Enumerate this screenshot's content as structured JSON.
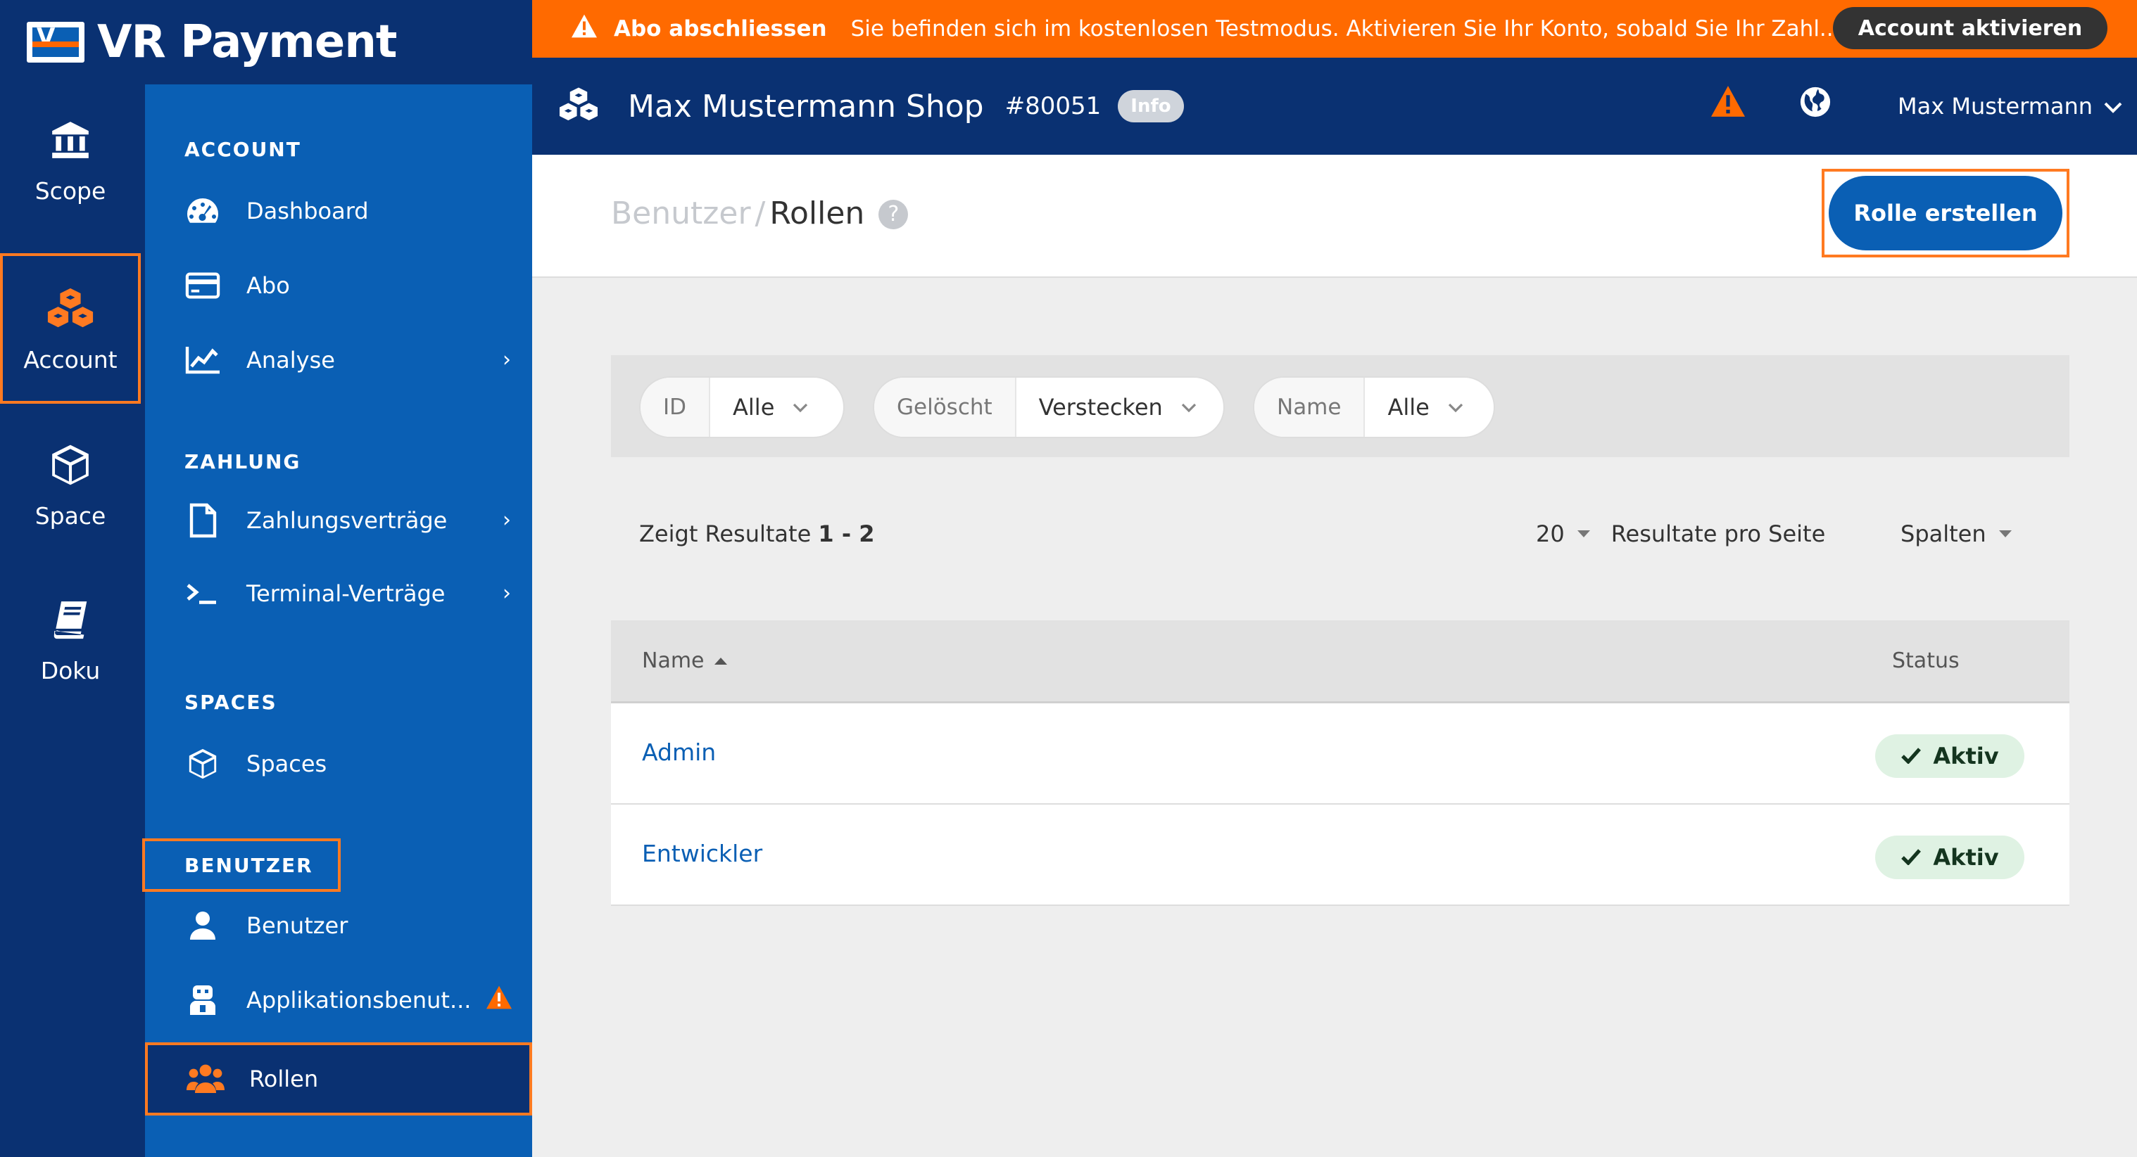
{
  "brand": {
    "name": "VR Payment",
    "logo_letter": "V"
  },
  "rail": [
    {
      "label": "Scope",
      "icon": "bank-icon"
    },
    {
      "label": "Account",
      "icon": "cubes-icon",
      "active": true
    },
    {
      "label": "Space",
      "icon": "cube-icon"
    },
    {
      "label": "Doku",
      "icon": "book-icon"
    }
  ],
  "sidebar": {
    "sections": {
      "account": "ACCOUNT",
      "zahlung": "ZAHLUNG",
      "spaces": "SPACES",
      "benutzer": "BENUTZER"
    },
    "items": {
      "dashboard": "Dashboard",
      "abo": "Abo",
      "analyse": "Analyse",
      "zahlungsvertraege": "Zahlungsverträge",
      "terminal": "Terminal-Verträge",
      "spaces": "Spaces",
      "benutzer": "Benutzer",
      "applikationsbenutzer": "Applikationsbenut...",
      "rollen": "Rollen"
    },
    "chevron": "›"
  },
  "banner": {
    "title": "Abo abschliessen",
    "message": "Sie befinden sich im kostenlosen Testmodus. Aktivieren Sie Ihr Konto, sobald Sie Ihr Zahl...",
    "button": "Account aktivieren",
    "color": "#ff6a00"
  },
  "header": {
    "shop_name": "Max Mustermann Shop",
    "shop_id": "#80051",
    "info_badge": "Info",
    "user_name": "Max Mustermann"
  },
  "page": {
    "breadcrumb_parent": "Benutzer",
    "breadcrumb_sep": "/",
    "title": "Rollen",
    "help": "?",
    "create_button": "Rolle erstellen"
  },
  "filters": [
    {
      "key": "ID",
      "value": "Alle"
    },
    {
      "key": "Gelöscht",
      "value": "Verstecken"
    },
    {
      "key": "Name",
      "value": "Alle"
    }
  ],
  "results": {
    "prefix": "Zeigt Resultate",
    "range": "1 - 2",
    "per_page_value": "20",
    "per_page_label": "Resultate pro Seite",
    "columns_label": "Spalten"
  },
  "table": {
    "headers": {
      "name": "Name",
      "status": "Status"
    },
    "rows": [
      {
        "name": "Admin",
        "status": "Aktiv"
      },
      {
        "name": "Entwickler",
        "status": "Aktiv"
      }
    ]
  },
  "colors": {
    "navy": "#0a3172",
    "blue": "#0a5fb4",
    "orange": "#ff6a00",
    "highlight": "#ff7a21"
  }
}
